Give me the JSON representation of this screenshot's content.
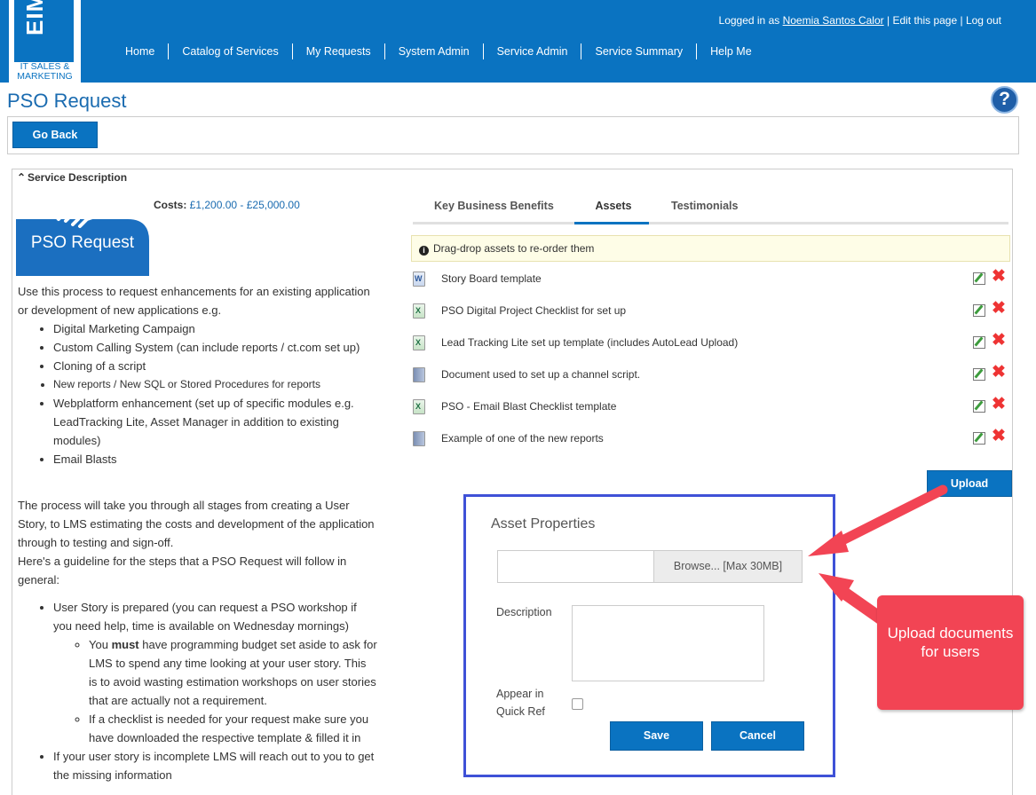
{
  "header": {
    "logo_text": "EIMS",
    "logo_sub": "IT SALES & MARKETING",
    "logged_in_prefix": "Logged in as ",
    "user_name": "Noemia Santos Calor",
    "edit_page": "Edit this page",
    "logout": "Log out",
    "separator": " | ",
    "nav": [
      "Home",
      "Catalog of Services",
      "My Requests",
      "System Admin",
      "Service Admin",
      "Service Summary",
      "Help Me"
    ]
  },
  "page": {
    "title": "PSO Request",
    "help_icon": "question-icon",
    "go_back": "Go Back"
  },
  "service": {
    "section_title": "Service Description",
    "image_caption": "PSO Request",
    "costs_label": "Costs: ",
    "costs_value": "£1,200.00 - £25,000.00",
    "intro": "Use this process to request enhancements for an existing application or development of new applications e.g.",
    "items": [
      "Digital Marketing Campaign",
      "Custom Calling System (can include reports / ct.com set up)",
      "Cloning of a script",
      "New reports / New SQL or Stored Procedures for reports",
      "Webplatform enhancement (set up of specific modules e.g. LeadTracking Lite, Asset Manager in addition to existing modules)",
      "Email Blasts"
    ],
    "para2": "The process will take you through all stages from creating a User Story, to LMS estimating the costs and development of the application through to testing and sign-off.",
    "para3": "Here's a guideline for the steps that a PSO Request will follow in general:",
    "step1": "User Story is prepared (you can request a PSO workshop if you need help, time is available on Wednesday mornings)",
    "step1_sub1_pre": "You ",
    "step1_sub1_bold": "must",
    "step1_sub1_post": " have programming budget set aside to ask for LMS to spend any time looking at your user story. This is to avoid wasting estimation workshops on user stories that are actually not a requirement.",
    "step1_sub2": "If a checklist is needed for your request make sure you have downloaded the respective template & filled it in",
    "step2": "If your user story is incomplete LMS will reach out to you to get the missing information"
  },
  "tabs": [
    "Key Business Benefits",
    "Assets",
    "Testimonials"
  ],
  "assets": {
    "notice": "Drag-drop assets to re-order them",
    "items": [
      {
        "name": "Story Board template",
        "icon": "word-file-icon"
      },
      {
        "name": "PSO Digital Project Checklist for set up",
        "icon": "excel-file-icon"
      },
      {
        "name": "Lead Tracking Lite set up template (includes AutoLead Upload)",
        "icon": "excel-file-icon"
      },
      {
        "name": "Document used to set up a channel script.",
        "icon": "document-file-icon"
      },
      {
        "name": "PSO - Email Blast Checklist template",
        "icon": "excel-file-icon"
      },
      {
        "name": "Example of one of the new reports",
        "icon": "document-file-icon"
      }
    ],
    "upload": "Upload"
  },
  "modal": {
    "title": "Asset Properties",
    "browse": "Browse... [Max 30MB]",
    "description_label": "Description",
    "quick_ref_label_1": "Appear in",
    "quick_ref_label_2": "Quick Ref",
    "save": "Save",
    "cancel": "Cancel"
  },
  "callout": {
    "text": "Upload documents for users"
  },
  "colors": {
    "brand_blue": "#0a73c1",
    "modal_border": "#3f51d7",
    "callout_red": "#f24454"
  }
}
